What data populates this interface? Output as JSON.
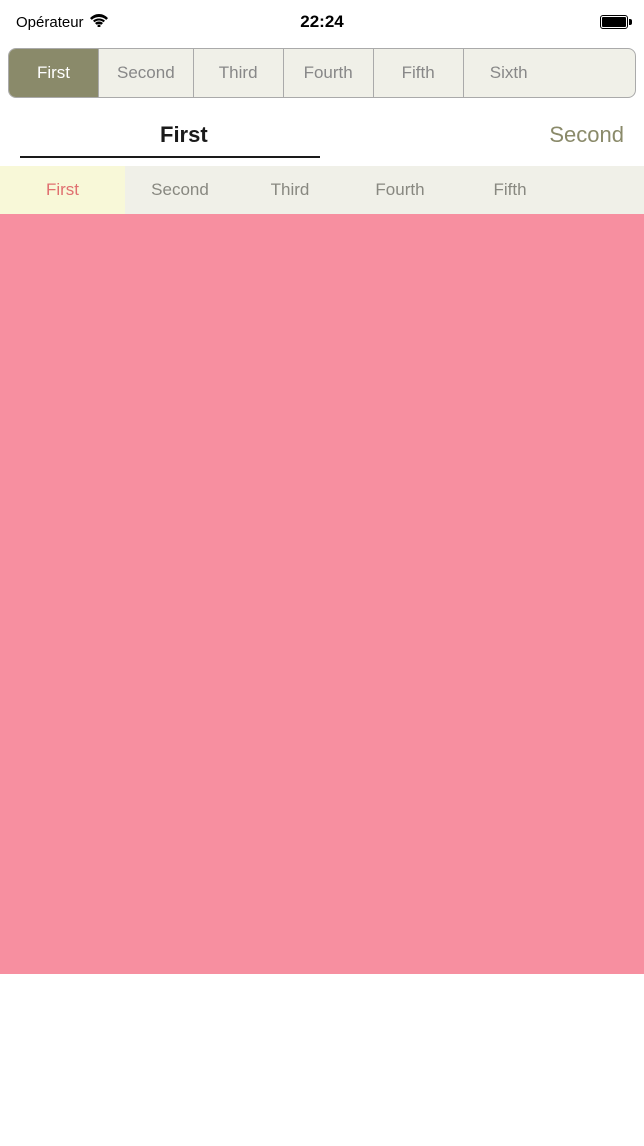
{
  "statusBar": {
    "carrier": "Opérateur",
    "time": "22:24"
  },
  "tabBar1": {
    "tabs": [
      {
        "label": "First",
        "active": true
      },
      {
        "label": "Second",
        "active": false
      },
      {
        "label": "Third",
        "active": false
      },
      {
        "label": "Fourth",
        "active": false
      },
      {
        "label": "Fifth",
        "active": false
      },
      {
        "label": "Sixth",
        "active": false
      }
    ]
  },
  "sectionLabels": {
    "first": "First",
    "second": "Second"
  },
  "tabBar2": {
    "tabs": [
      {
        "label": "First",
        "active": true
      },
      {
        "label": "Second",
        "active": false
      },
      {
        "label": "Third",
        "active": false
      },
      {
        "label": "Fourth",
        "active": false
      },
      {
        "label": "Fifth",
        "active": false
      }
    ]
  }
}
